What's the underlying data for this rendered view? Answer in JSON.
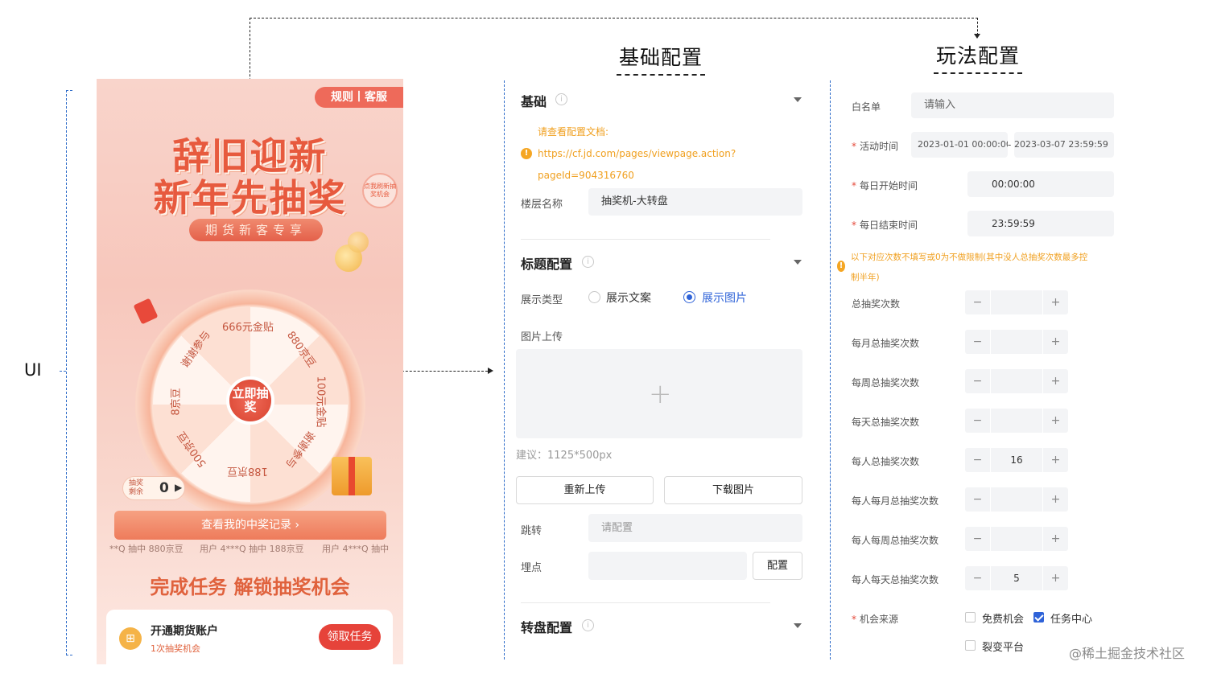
{
  "headings": {
    "basic": "基础配置",
    "play": "玩法配置",
    "ui": "UI"
  },
  "phone": {
    "rule_tag": "规则丨客服",
    "title_line1": "辞旧迎新",
    "title_line2": "新年先抽奖",
    "refresh_badge": "点我刷新抽奖机会",
    "subtitle": "期货新客专享",
    "wheel_center": "立即抽奖",
    "prizes": [
      "666元金贴",
      "880京豆",
      "100元金贴",
      "谢谢参与",
      "188京豆",
      "500京豆",
      "8京豆",
      "谢谢参与"
    ],
    "remain_label": "抽奖剩余",
    "remain_count": "0",
    "record_button": "查看我的中奖记录 ›",
    "marquee": [
      "**Q 抽中 880京豆",
      "用户 4***Q 抽中 188京豆",
      "用户 4***Q 抽中"
    ],
    "task_title": "完成任务 解锁抽奖机会",
    "task_name": "开通期货账户",
    "task_sub": "1次抽奖机会",
    "task_button": "领取任务",
    "task_icon": "gift-icon"
  },
  "basic": {
    "section_title": "基础",
    "doc_hint": "请查看配置文档:",
    "doc_link_1": "https://cf.jd.com/pages/viewpage.action?",
    "doc_link_2": "pageId=904316760",
    "floor_label": "楼层名称",
    "floor_value": "抽奖机-大转盘",
    "title_section": "标题配置",
    "display_type_label": "展示类型",
    "opt_text": "展示文案",
    "opt_image": "展示图片",
    "selected_option": "展示图片",
    "upload_label": "图片上传",
    "upload_hint": "建议：1125*500px",
    "reupload": "重新上传",
    "download": "下载图片",
    "jump_label": "跳转",
    "jump_placeholder": "请配置",
    "track_label": "埋点",
    "track_button": "配置",
    "wheel_section": "转盘配置"
  },
  "play": {
    "whitelist_label": "白名单",
    "whitelist_placeholder": "请输入",
    "activity_time_label": "活动时间",
    "activity_start": "2023-01-01 00:00:00",
    "activity_sep": "-",
    "activity_end": "2023-03-07 23:59:59",
    "daily_start_label": "每日开始时间",
    "daily_start": "00:00:00",
    "daily_end_label": "每日结束时间",
    "daily_end": "23:59:59",
    "warning_1": "以下对应次数不填写或0为不做限制(其中没人总抽奖次数最多控",
    "warning_2": "制半年)",
    "counters": [
      {
        "label": "总抽奖次数",
        "value": ""
      },
      {
        "label": "每月总抽奖次数",
        "value": ""
      },
      {
        "label": "每周总抽奖次数",
        "value": ""
      },
      {
        "label": "每天总抽奖次数",
        "value": ""
      },
      {
        "label": "每人总抽奖次数",
        "value": "16"
      },
      {
        "label": "每人每月总抽奖次数",
        "value": ""
      },
      {
        "label": "每人每周总抽奖次数",
        "value": ""
      },
      {
        "label": "每人每天总抽奖次数",
        "value": "5"
      }
    ],
    "source_label": "机会来源",
    "source_options": [
      {
        "label": "免费机会",
        "checked": false
      },
      {
        "label": "任务中心",
        "checked": true
      },
      {
        "label": "裂变平台",
        "checked": false
      }
    ]
  },
  "watermark": "@稀土掘金技术社区",
  "colors": {
    "accent": "#2f63d8",
    "warning": "#f0a020",
    "danger": "#e4493a",
    "brand_red": "#e75a3e"
  }
}
